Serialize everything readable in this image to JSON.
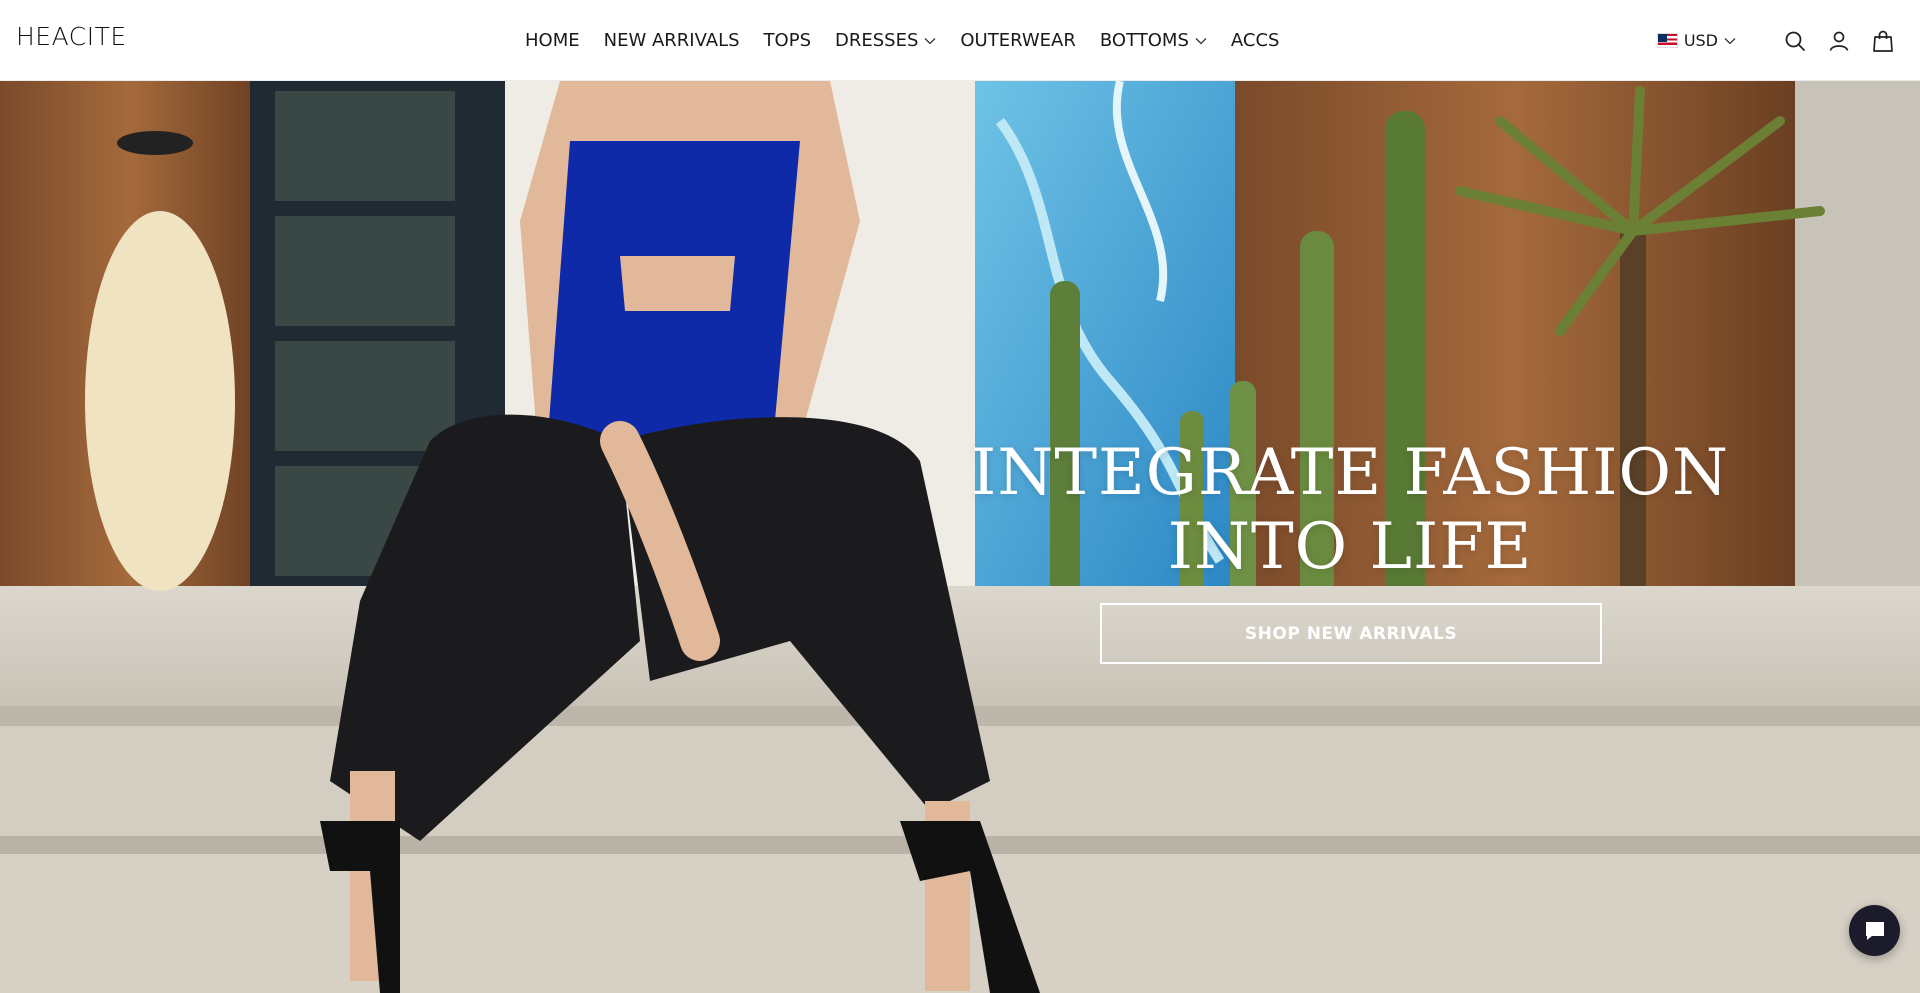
{
  "brand": {
    "logo_text": "HEACITE"
  },
  "nav": {
    "items": [
      {
        "label": "HOME",
        "has_dropdown": false
      },
      {
        "label": "NEW ARRIVALS",
        "has_dropdown": false
      },
      {
        "label": "TOPS",
        "has_dropdown": false
      },
      {
        "label": "DRESSES",
        "has_dropdown": true
      },
      {
        "label": "OUTERWEAR",
        "has_dropdown": false
      },
      {
        "label": "BOTTOMS",
        "has_dropdown": true
      },
      {
        "label": "ACCS",
        "has_dropdown": false
      }
    ]
  },
  "header": {
    "currency": {
      "label": "USD",
      "flag": "us-flag-icon"
    },
    "icons": [
      "search-icon",
      "account-icon",
      "cart-bag-icon"
    ]
  },
  "hero": {
    "title_line1": "INTEGRATE FASHION",
    "title_line2": "INTO LIFE",
    "cta_label": "SHOP NEW ARRIVALS",
    "image_alt": ""
  },
  "chat": {
    "icon": "chat-bubble-icon"
  },
  "colors": {
    "cta_border": "#ffffff",
    "chat_bg": "#1c1b2c",
    "header_bg": "#ffffff"
  }
}
